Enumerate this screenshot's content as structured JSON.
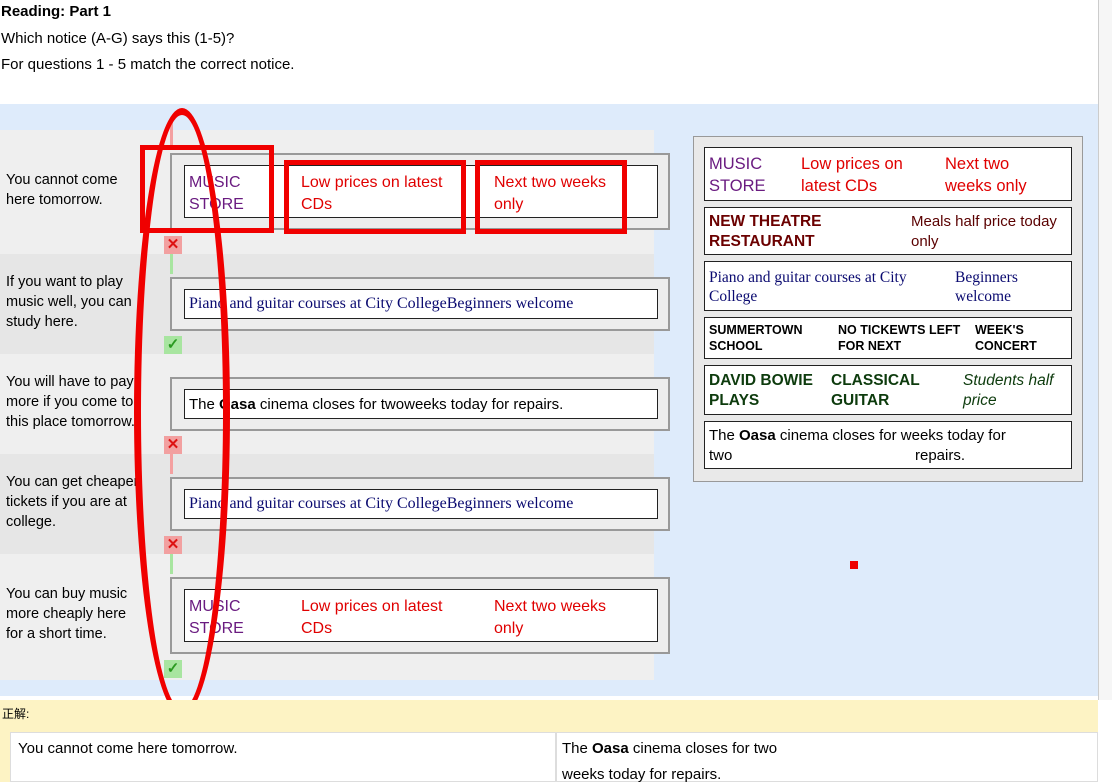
{
  "header": {
    "title": "Reading: Part 1",
    "line1": "Which notice (A-G) says this (1-5)?",
    "line2": "For questions 1 - 5 match the correct notice."
  },
  "questions": [
    {
      "text": "You cannot come here tomorrow.",
      "result": "incorrect"
    },
    {
      "text": "If you want to play music well, you can study here.",
      "result": "correct"
    },
    {
      "text": "You will have to pay more if you come to this place tomorrow.",
      "result": "incorrect"
    },
    {
      "text": "You can get cheaper tickets if you are at college.",
      "result": "incorrect"
    },
    {
      "text": "You can buy music more cheaply here for a short time.",
      "result": "correct"
    }
  ],
  "notices": {
    "music_store": {
      "a": "MUSIC STORE",
      "b": "Low prices on latest CDs",
      "c": "Next two weeks only",
      "c_wrap": "Next two weeks only"
    },
    "theatre": {
      "a": "NEW THEATRE RESTAURANT",
      "b": "Meals half price today only"
    },
    "piano": {
      "a": "Piano and guitar courses at City College",
      "b": "Beginners welcome",
      "inline": "Piano and guitar courses at City CollegeBeginners welcome"
    },
    "summertown": {
      "a": "SUMMERTOWN SCHOOL",
      "b": "NO TICKEWTS LEFT FOR NEXT",
      "c": "WEEK'S CONCERT"
    },
    "bowie": {
      "a": "DAVID BOWIE PLAYS",
      "b": "CLASSICAL GUITAR",
      "c": "Students half price"
    },
    "oasa": {
      "pre": "The ",
      "name": "Oasa",
      "post": " cinema closes for weeks today for",
      "l2a": "two",
      "l2b": "repairs.",
      "inline_post": " cinema closes for twoweeks today for repairs."
    }
  },
  "marks": {
    "incorrect": "✕",
    "correct": "✓"
  },
  "answer": {
    "label": "正解:",
    "question": "You cannot come here tomorrow.",
    "notice_pre": "The ",
    "notice_name": "Oasa",
    "notice_post": " cinema closes for two",
    "notice_line2": "weeks today for repairs."
  },
  "colors": {
    "highlight": "#f00000",
    "panel": "#deebfb",
    "answer_bg": "#fdf3c4"
  }
}
